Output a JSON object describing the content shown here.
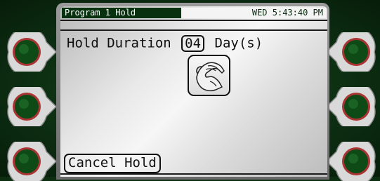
{
  "status_bar": {
    "title": "Program 1 Hold",
    "datetime": "WED 5:43:40 PM"
  },
  "hold": {
    "label": "Hold Duration",
    "value": "04",
    "unit": "Day(s)"
  },
  "touch_icon": "finger-adjust-icon",
  "cancel_label": "Cancel Hold",
  "colors": {
    "bezel": "#0e2e12",
    "title_bar": "#07310f",
    "softkey_rim": "#c0392b",
    "softkey_center": "#0d4a16"
  }
}
